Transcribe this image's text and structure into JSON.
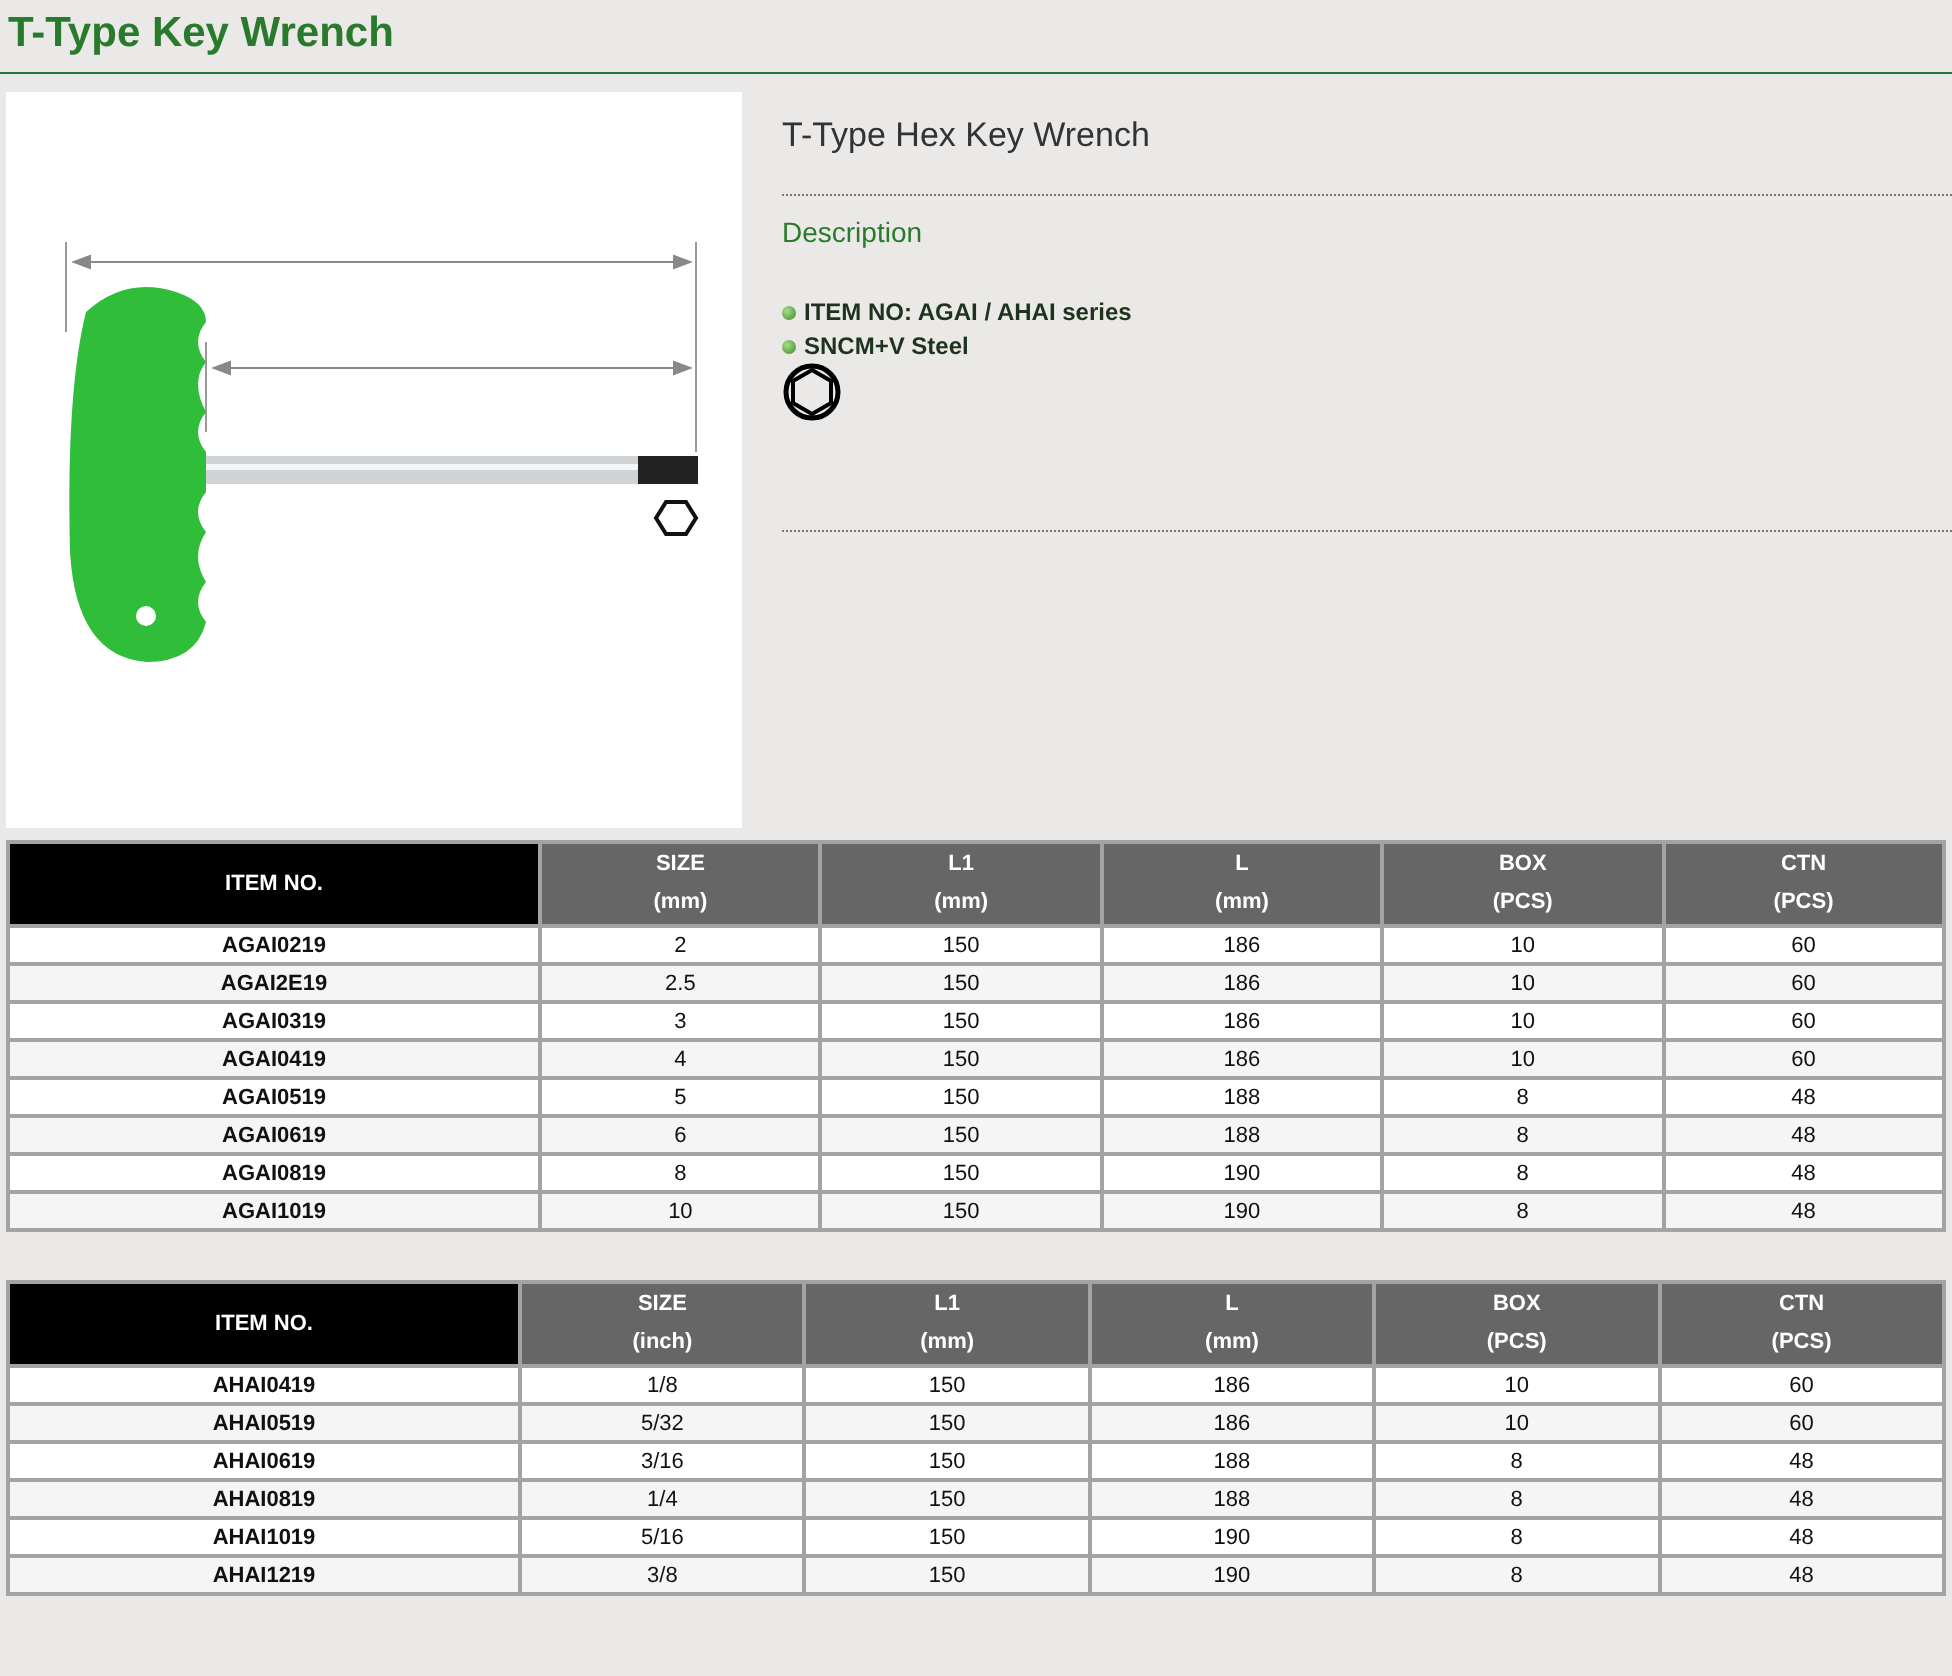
{
  "title": "T-Type Key Wrench",
  "product": {
    "name": "T-Type Hex Key Wrench",
    "section": "Description",
    "features": [
      "ITEM NO: AGAI / AHAI series",
      "SNCM+V Steel"
    ]
  },
  "tables": [
    {
      "columns": [
        {
          "label": "ITEM NO."
        },
        {
          "label": "SIZE",
          "unit": "(mm)"
        },
        {
          "label": "L1",
          "unit": "(mm)"
        },
        {
          "label": "L",
          "unit": "(mm)"
        },
        {
          "label": "BOX",
          "unit": "(PCS)"
        },
        {
          "label": "CTN",
          "unit": "(PCS)"
        }
      ],
      "rows": [
        [
          "AGAI0219",
          "2",
          "150",
          "186",
          "10",
          "60"
        ],
        [
          "AGAI2E19",
          "2.5",
          "150",
          "186",
          "10",
          "60"
        ],
        [
          "AGAI0319",
          "3",
          "150",
          "186",
          "10",
          "60"
        ],
        [
          "AGAI0419",
          "4",
          "150",
          "186",
          "10",
          "60"
        ],
        [
          "AGAI0519",
          "5",
          "150",
          "188",
          "8",
          "48"
        ],
        [
          "AGAI0619",
          "6",
          "150",
          "188",
          "8",
          "48"
        ],
        [
          "AGAI0819",
          "8",
          "150",
          "190",
          "8",
          "48"
        ],
        [
          "AGAI1019",
          "10",
          "150",
          "190",
          "8",
          "48"
        ]
      ]
    },
    {
      "columns": [
        {
          "label": "ITEM NO."
        },
        {
          "label": "SIZE",
          "unit": "(inch)"
        },
        {
          "label": "L1",
          "unit": "(mm)"
        },
        {
          "label": "L",
          "unit": "(mm)"
        },
        {
          "label": "BOX",
          "unit": "(PCS)"
        },
        {
          "label": "CTN",
          "unit": "(PCS)"
        }
      ],
      "rows": [
        [
          "AHAI0419",
          "1/8",
          "150",
          "186",
          "10",
          "60"
        ],
        [
          "AHAI0519",
          "5/32",
          "150",
          "186",
          "10",
          "60"
        ],
        [
          "AHAI0619",
          "3/16",
          "150",
          "188",
          "8",
          "48"
        ],
        [
          "AHAI0819",
          "1/4",
          "150",
          "188",
          "8",
          "48"
        ],
        [
          "AHAI1019",
          "5/16",
          "150",
          "190",
          "8",
          "48"
        ],
        [
          "AHAI1219",
          "3/8",
          "150",
          "190",
          "8",
          "48"
        ]
      ]
    }
  ]
}
